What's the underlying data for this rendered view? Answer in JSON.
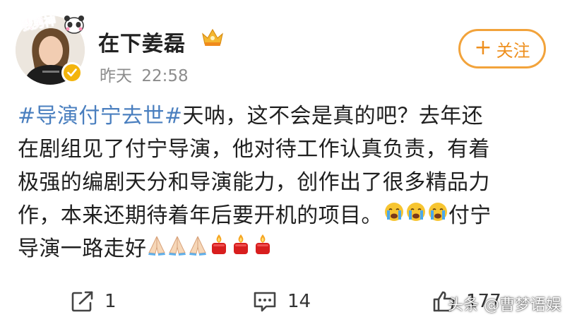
{
  "profile": {
    "avatar_sticker": "我男神",
    "username": "在下姜磊",
    "time_label": "昨天",
    "time_value": "22:58"
  },
  "follow_button": {
    "plus": "+",
    "label": "关注"
  },
  "post": {
    "hashtag": "#导演付宁去世#",
    "line1_rest": " 天呐，这不会是真的吧？去年还",
    "line2": "在剧组见了付宁导演，他对待工作认真负责，有着",
    "line3": "极强的编剧天分和导演能力，创作出了很多精品力",
    "line4_text": "作，本来还期待着年后要开机的项目。",
    "line4_tail": "付宁",
    "line5_text": "导演一路走好"
  },
  "emoji": {
    "crying": "crying-face-icon",
    "pray": "folded-hands-icon",
    "candle": "candle-icon"
  },
  "actions": {
    "repost_count": "1",
    "comment_count": "14",
    "like_count": "177"
  },
  "watermark": "头条 @曹梦语娱",
  "colors": {
    "hashtag": "#4a7fbf",
    "follow_orange": "#ee8f1e",
    "verified_gold": "#f3b40c",
    "time_gray": "#8c8c8c"
  }
}
